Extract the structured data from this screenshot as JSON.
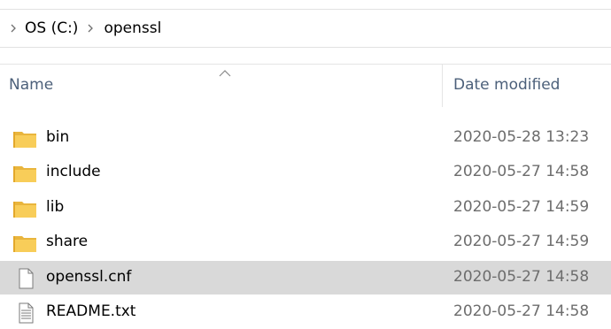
{
  "breadcrumb": {
    "items": [
      "OS (C:)",
      "openssl"
    ]
  },
  "columns": {
    "name": "Name",
    "date_modified": "Date modified",
    "sorted_by": "Name",
    "sort_direction": "ascending"
  },
  "colors": {
    "folder": "#f8cd59",
    "folder_dark": "#e9b53d",
    "header_text": "#4c607a",
    "date_text": "#6d6d6d",
    "selected_row": "#d9d9d9"
  },
  "files": [
    {
      "name": "bin",
      "date": "2020-05-28 13:23",
      "icon": "folder-icon",
      "selected": false
    },
    {
      "name": "include",
      "date": "2020-05-27 14:58",
      "icon": "folder-icon",
      "selected": false
    },
    {
      "name": "lib",
      "date": "2020-05-27 14:59",
      "icon": "folder-icon",
      "selected": false
    },
    {
      "name": "share",
      "date": "2020-05-27 14:59",
      "icon": "folder-icon",
      "selected": false
    },
    {
      "name": "openssl.cnf",
      "date": "2020-05-27 14:58",
      "icon": "file-icon",
      "selected": true
    },
    {
      "name": "README.txt",
      "date": "2020-05-27 14:58",
      "icon": "text-file-icon",
      "selected": false
    }
  ]
}
